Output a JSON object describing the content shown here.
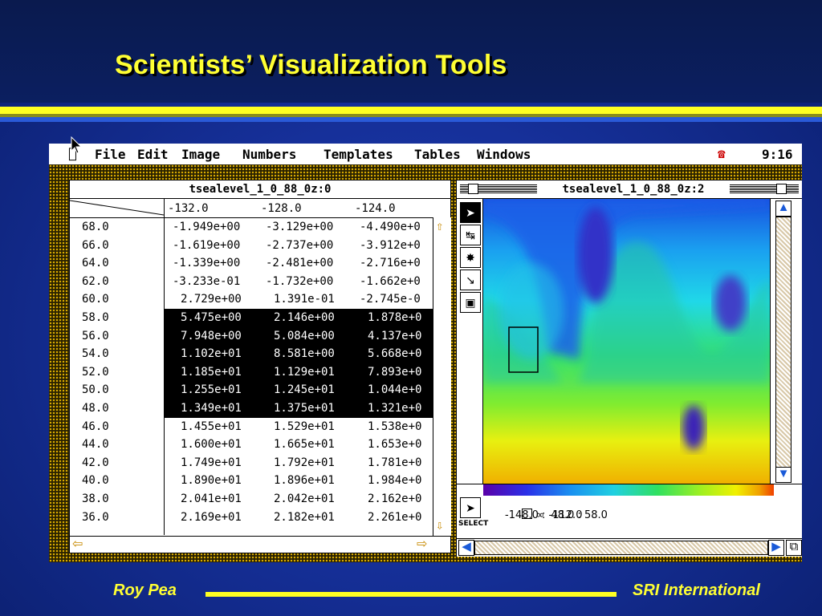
{
  "slide": {
    "title": "Scientists’ Visualization Tools",
    "footer_left": "Roy Pea",
    "footer_right": "SRI International",
    "accent_color": "#ffff33"
  },
  "menubar": {
    "items": [
      "File",
      "Edit",
      "Image",
      "Numbers",
      "Templates",
      "Tables",
      "Windows"
    ],
    "clock": "9:16",
    "apple_icon": "apple-icon",
    "phone_icon": "phone-icon"
  },
  "spreadsheet": {
    "title": "tsealevel_1_0_88_0z:0",
    "columns": [
      "-132.0",
      "-128.0",
      "-124.0"
    ],
    "rows": [
      {
        "label": "68.0",
        "cells": [
          "-1.949e+00",
          "-3.129e+00",
          "-4.490e+0"
        ]
      },
      {
        "label": "66.0",
        "cells": [
          "-1.619e+00",
          "-2.737e+00",
          "-3.912e+0"
        ]
      },
      {
        "label": "64.0",
        "cells": [
          "-1.339e+00",
          "-2.481e+00",
          "-2.716e+0"
        ]
      },
      {
        "label": "62.0",
        "cells": [
          "-3.233e-01",
          "-1.732e+00",
          "-1.662e+0"
        ]
      },
      {
        "label": "60.0",
        "cells": [
          "2.729e+00",
          "1.391e-01",
          "-2.745e-0"
        ]
      },
      {
        "label": "58.0",
        "cells": [
          "5.475e+00",
          "2.146e+00",
          "1.878e+0"
        ]
      },
      {
        "label": "56.0",
        "cells": [
          "7.948e+00",
          "5.084e+00",
          "4.137e+0"
        ]
      },
      {
        "label": "54.0",
        "cells": [
          "1.102e+01",
          "8.581e+00",
          "5.668e+0"
        ]
      },
      {
        "label": "52.0",
        "cells": [
          "1.185e+01",
          "1.129e+01",
          "7.893e+0"
        ]
      },
      {
        "label": "50.0",
        "cells": [
          "1.255e+01",
          "1.245e+01",
          "1.044e+0"
        ]
      },
      {
        "label": "48.0",
        "cells": [
          "1.349e+01",
          "1.375e+01",
          "1.321e+0"
        ]
      },
      {
        "label": "46.0",
        "cells": [
          "1.455e+01",
          "1.529e+01",
          "1.538e+0"
        ]
      },
      {
        "label": "44.0",
        "cells": [
          "1.600e+01",
          "1.665e+01",
          "1.653e+0"
        ]
      },
      {
        "label": "42.0",
        "cells": [
          "1.749e+01",
          "1.792e+01",
          "1.781e+0"
        ]
      },
      {
        "label": "40.0",
        "cells": [
          "1.890e+01",
          "1.896e+01",
          "1.984e+0"
        ]
      },
      {
        "label": "38.0",
        "cells": [
          "2.041e+01",
          "2.042e+01",
          "2.162e+0"
        ]
      },
      {
        "label": "36.0",
        "cells": [
          "2.169e+01",
          "2.182e+01",
          "2.261e+0"
        ]
      }
    ],
    "selected_rows": [
      "58.0",
      "56.0",
      "54.0",
      "52.0",
      "50.0",
      "48.0"
    ]
  },
  "image_window": {
    "title": "tsealevel_1_0_88_0z:2",
    "tools": [
      "arrow-tool-icon",
      "ruler-tool-icon",
      "probe-tool-icon",
      "zoom-tool-icon",
      "frame-tool-icon"
    ],
    "select_label": "SELECT",
    "info_line1": "∞  48.0 : 58.0",
    "info_line2": "-148.0 : -112.0",
    "colormap": [
      "#5a00a8",
      "#2a30e8",
      "#1a90f0",
      "#20d0e0",
      "#30e060",
      "#a0f020",
      "#f0f000",
      "#f0a000",
      "#f04000"
    ]
  }
}
